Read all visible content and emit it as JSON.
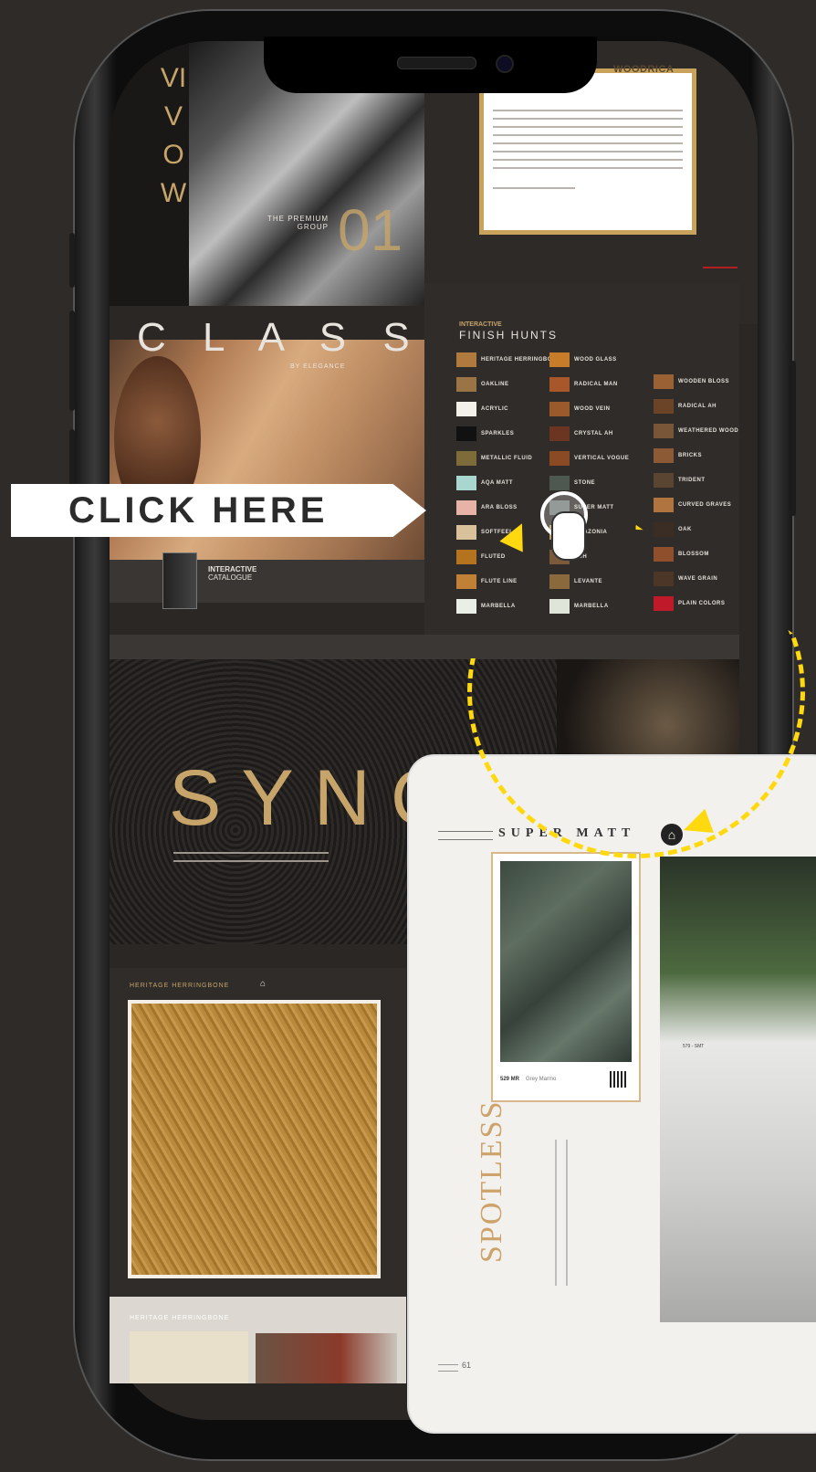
{
  "brand": {
    "name": "WOODRICA"
  },
  "vivow": {
    "title": "VIVOW",
    "number": "01",
    "subtitle": "THE PREMIUM GROUP"
  },
  "class": {
    "title": "C L A S S",
    "subtitle": "BY ELEGANCE"
  },
  "catalogue": {
    "label": "INTERACTIVE",
    "title": "CATALOGUE"
  },
  "finish_hunts": {
    "label": "INTERACTIVE",
    "title": "FINISH HUNTS"
  },
  "swatches": {
    "col1": [
      {
        "label": "HERITAGE HERRINGBONE",
        "color": "#b07a3e"
      },
      {
        "label": "OAKLINE",
        "color": "#9b7446"
      },
      {
        "label": "ACRYLIC",
        "color": "#f4f1ea"
      },
      {
        "label": "SPARKLES",
        "color": "#111111"
      },
      {
        "label": "METALLIC FLUID",
        "color": "#7e6b3a"
      },
      {
        "label": "AQA MATT",
        "color": "#a9d7d0"
      },
      {
        "label": "ARA BLOSS",
        "color": "#e6b3a6"
      },
      {
        "label": "SOFTFEEL",
        "color": "#d9c29b"
      },
      {
        "label": "FLUTED",
        "color": "#b4731f"
      },
      {
        "label": "FLUTE LINE",
        "color": "#c08036"
      },
      {
        "label": "MARBELLA",
        "color": "#e9efe6"
      }
    ],
    "col2": [
      {
        "label": "WOOD GLASS",
        "color": "#c77c29"
      },
      {
        "label": "RADICAL MAN",
        "color": "#a8572a"
      },
      {
        "label": "WOOD VEIN",
        "color": "#9b5a2c"
      },
      {
        "label": "CRYSTAL AH",
        "color": "#6b3522"
      },
      {
        "label": "VERTICAL VOGUE",
        "color": "#8a4a24"
      },
      {
        "label": "STONE",
        "color": "#4e5750"
      },
      {
        "label": "SUPER MATT",
        "color": "#6f7874"
      },
      {
        "label": "AMAZONIA",
        "color": "#b9a16b"
      },
      {
        "label": "ASH",
        "color": "#7a5a3a"
      },
      {
        "label": "LEVANTE",
        "color": "#8a6a3c"
      },
      {
        "label": "MARBELLA",
        "color": "#dfe5d8"
      }
    ],
    "col3": [
      {
        "label": "WOODEN BLOSS",
        "color": "#9a6134"
      },
      {
        "label": "RADICAL AH",
        "color": "#6b4326"
      },
      {
        "label": "WEATHERED WOOD",
        "color": "#7a5638"
      },
      {
        "label": "BRICKS",
        "color": "#8c5b35"
      },
      {
        "label": "TRIDENT",
        "color": "#5a4533"
      },
      {
        "label": "CURVED GRAVES",
        "color": "#b07440"
      },
      {
        "label": "OAK",
        "color": "#3b2d24"
      },
      {
        "label": "BLOSSOM",
        "color": "#8f4f2c"
      },
      {
        "label": "WAVE GRAIN",
        "color": "#4b3628"
      },
      {
        "label": "PLAIN COLORS",
        "color": "#c0192a"
      }
    ]
  },
  "sync": {
    "title": "SYNC"
  },
  "heritage": {
    "title": "HERITAGE HERRINGBONE",
    "title2": "HERITAGE HERRINGBONE"
  },
  "cta": {
    "label": "CLICK HERE"
  },
  "overlay": {
    "section_title": "SUPER MATT",
    "sample_code": "529 MR",
    "sample_name": "Grey Marmo",
    "image_code": "579 - SMT",
    "vertical_title": "SPOTLESS",
    "page_number": "61"
  }
}
